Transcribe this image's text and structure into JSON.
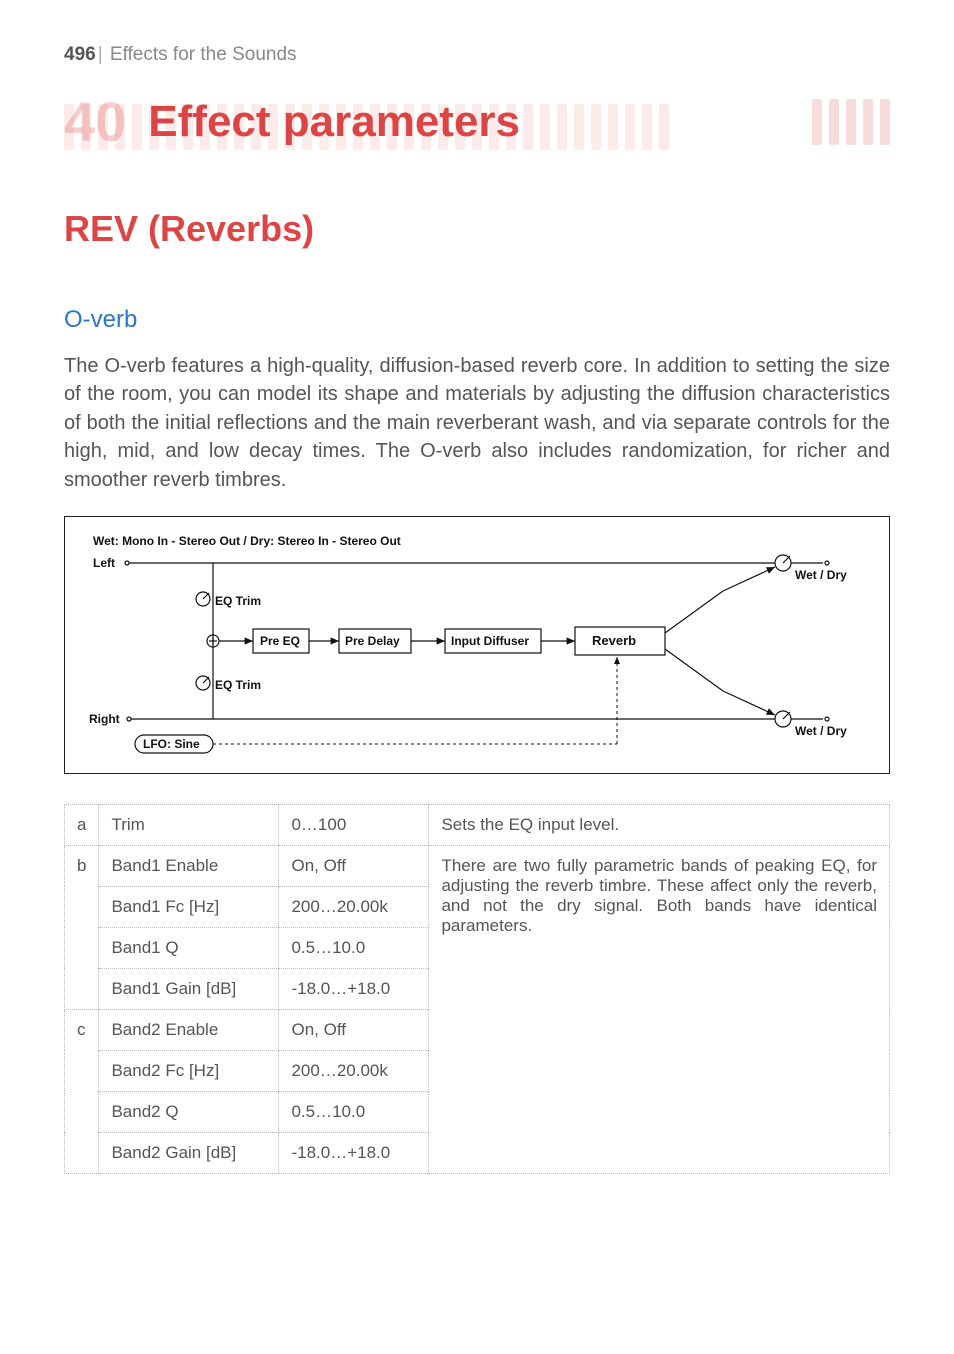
{
  "header": {
    "page_number": "496",
    "separator": "|",
    "section": "Effects for the Sounds"
  },
  "chapter": {
    "number": "40",
    "title": "Effect parameters"
  },
  "section_heading": "REV (Reverbs)",
  "sub_heading": "O-verb",
  "body": "The O-verb features a high-quality, diffusion-based reverb core. In addition to setting the size of the room, you can model its shape and materials by adjusting the diffusion characteristics of both the initial reflections and the main reverberant wash, and via separate controls for the high, mid, and low decay times. The O-verb also includes randomization, for richer and smoother reverb timbres.",
  "diagram": {
    "caption": "Wet: Mono In - Stereo Out  /  Dry: Stereo In - Stereo Out",
    "left_label": "Left",
    "right_label": "Right",
    "eq_trim": "EQ Trim",
    "pre_eq": "Pre EQ",
    "pre_delay": "Pre Delay",
    "input_diffuser": "Input Diffuser",
    "reverb": "Reverb",
    "wet_dry": "Wet / Dry",
    "lfo": "LFO: Sine"
  },
  "table": {
    "rows": [
      {
        "key": "a",
        "name": "Trim",
        "range": "0…100",
        "desc": "Sets the EQ input level."
      },
      {
        "key": "b",
        "name": "Band1 Enable",
        "range": "On, Off",
        "desc": "There are two fully parametric bands of peaking EQ, for adjusting the reverb timbre. These affect only the reverb, and not the dry signal. Both bands have identical parameters."
      },
      {
        "key": "",
        "name": "Band1 Fc [Hz]",
        "range": "200…20.00k",
        "desc": ""
      },
      {
        "key": "",
        "name": "Band1 Q",
        "range": "0.5…10.0",
        "desc": ""
      },
      {
        "key": "",
        "name": "Band1 Gain [dB]",
        "range": "-18.0…+18.0",
        "desc": ""
      },
      {
        "key": "c",
        "name": "Band2 Enable",
        "range": "On, Off",
        "desc": ""
      },
      {
        "key": "",
        "name": "Band2 Fc [Hz]",
        "range": "200…20.00k",
        "desc": ""
      },
      {
        "key": "",
        "name": "Band2 Q",
        "range": "0.5…10.0",
        "desc": ""
      },
      {
        "key": "",
        "name": "Band2 Gain [dB]",
        "range": "-18.0…+18.0",
        "desc": ""
      }
    ]
  }
}
